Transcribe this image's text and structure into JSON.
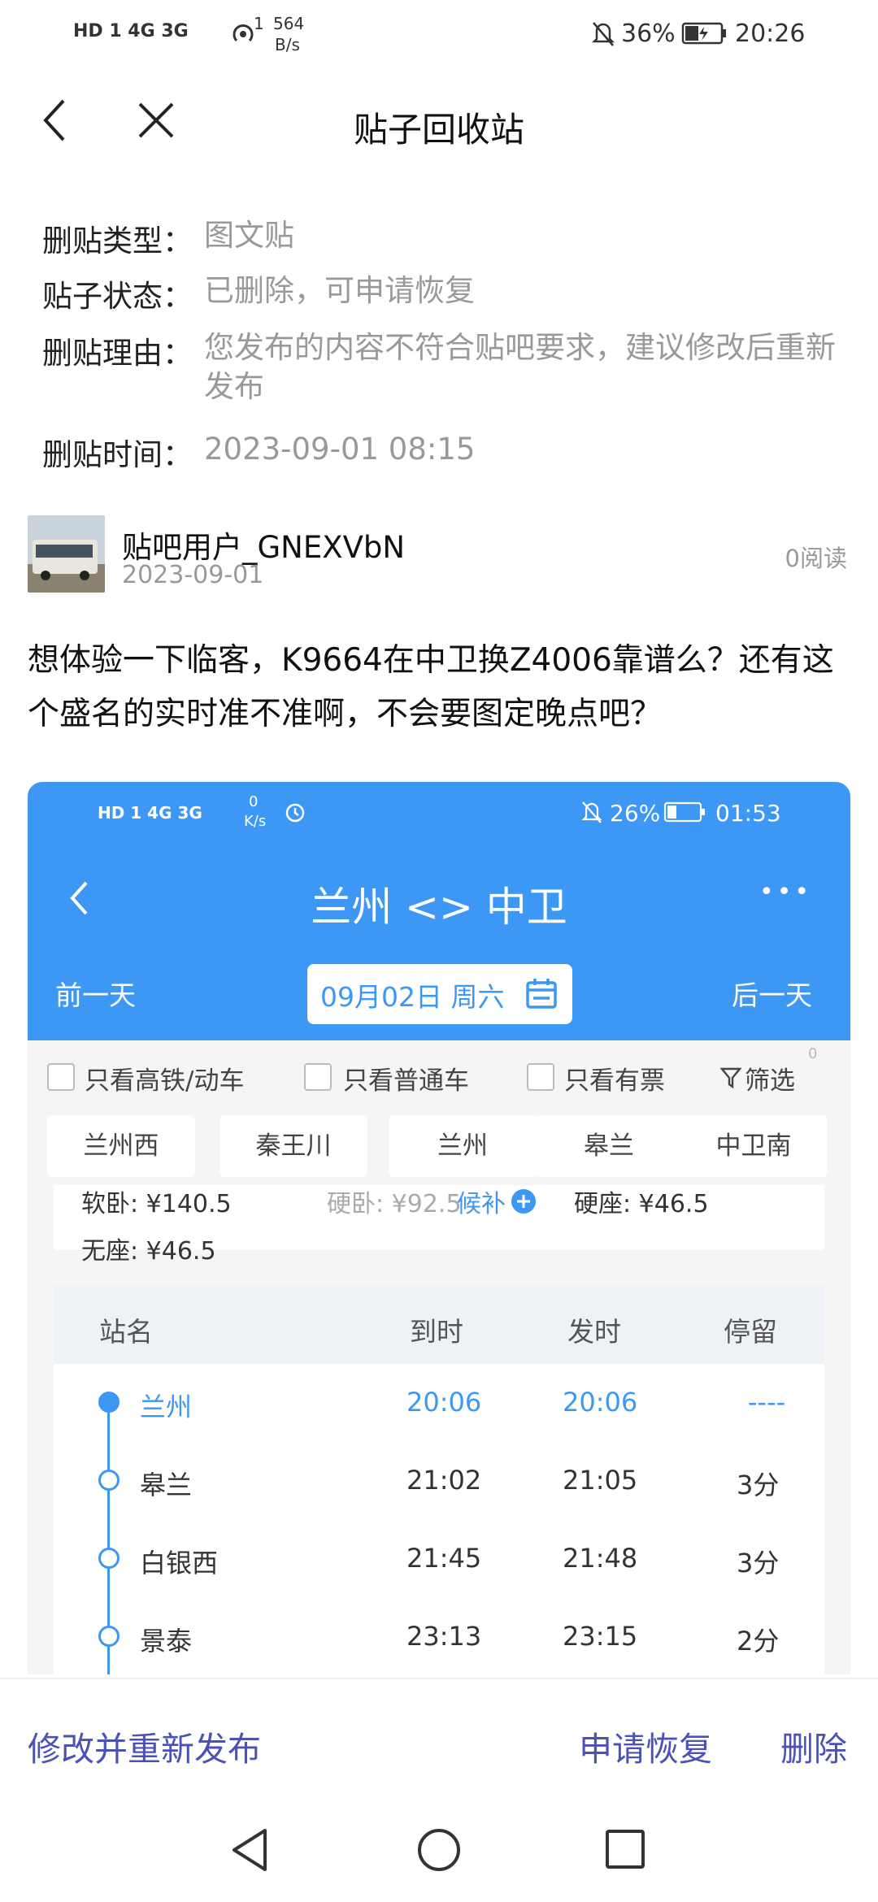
{
  "status_bar": {
    "left_icons": "HD 1 4G 3G",
    "net_speed_value": "564",
    "net_speed_unit": "B/s",
    "hotspot_count": "1",
    "battery": "36%",
    "time": "20:26"
  },
  "header": {
    "title": "贴子回收站"
  },
  "info": [
    {
      "label": "删贴类型：",
      "value": "图文贴"
    },
    {
      "label": "贴子状态：",
      "value": "已删除，可申请恢复"
    },
    {
      "label": "删贴理由：",
      "value": "您发布的内容不符合贴吧要求，建议修改后重新发布"
    },
    {
      "label": "删贴时间：",
      "value": "2023-09-01 08:15"
    }
  ],
  "post": {
    "username": "贴吧用户_GNEXVbN",
    "date": "2023-09-01",
    "reads": "0阅读",
    "text": "想体验一下临客，K9664在中卫换Z4006靠谱么？还有这个盛名的实时准不准啊，不会要图定晚点吧？"
  },
  "shot": {
    "status": {
      "left_icons": "HD 1 4G 3G",
      "speed_value": "0",
      "speed_unit": "K/s",
      "battery": "26%",
      "time": "01:53"
    },
    "route_title": "兰州 <> 中卫",
    "more": "•••",
    "prev_day": "前一天",
    "next_day": "后一天",
    "date": "09月02日 周六",
    "filters": [
      "只看高铁/动车",
      "只看普通车",
      "只看有票"
    ],
    "filter_button": "筛选",
    "filter_count": "0",
    "stations_chips": [
      "兰州西",
      "秦王川",
      "兰州",
      "皋兰",
      "中卫南"
    ],
    "prices": {
      "soft_sleeper": "软卧: ¥140.5",
      "hard_sleeper": "硬卧: ¥92.5",
      "waitlist": "候补",
      "hard_seat": "硬座: ¥46.5",
      "no_seat": "无座: ¥46.5"
    },
    "table_headers": [
      "站名",
      "到时",
      "发时",
      "停留"
    ],
    "rows": [
      {
        "station": "兰州",
        "arrive": "20:06",
        "depart": "20:06",
        "stop": "----"
      },
      {
        "station": "皋兰",
        "arrive": "21:02",
        "depart": "21:05",
        "stop": "3分"
      },
      {
        "station": "白银西",
        "arrive": "21:45",
        "depart": "21:48",
        "stop": "3分"
      },
      {
        "station": "景泰",
        "arrive": "23:13",
        "depart": "23:15",
        "stop": "2分"
      }
    ],
    "accent": "#3d97f4"
  },
  "actions": {
    "edit_republish": "修改并重新发布",
    "restore": "申请恢复",
    "delete": "删除"
  },
  "accent_purple": "#4a53b5"
}
